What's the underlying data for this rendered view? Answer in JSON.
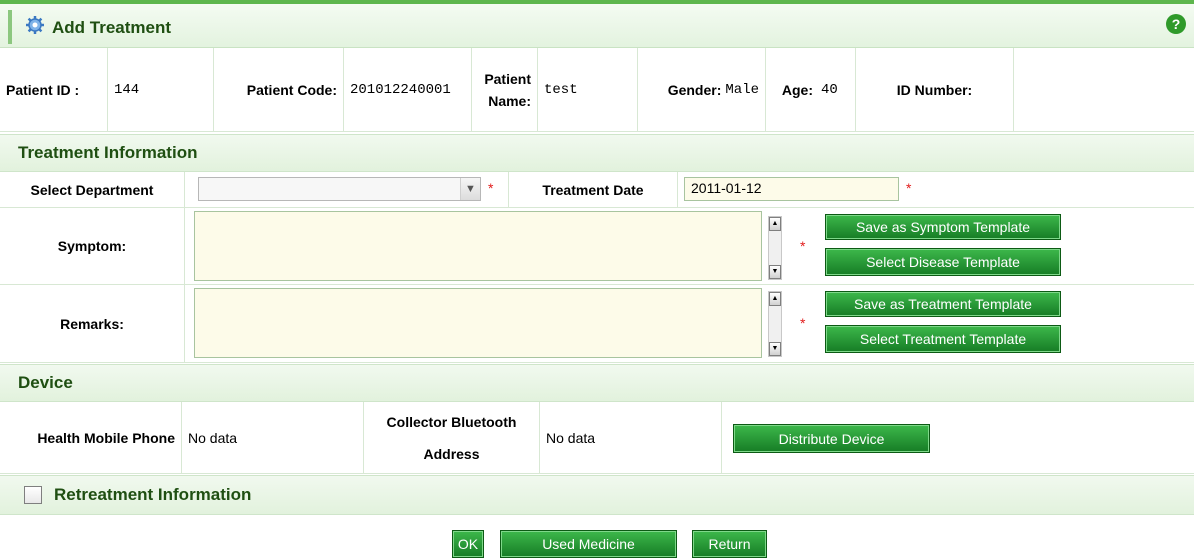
{
  "header": {
    "title": "Add Treatment",
    "help_icon": "help-icon"
  },
  "patient": {
    "id_label": "Patient ID :",
    "id_value": "144",
    "code_label": "Patient Code:",
    "code_value": "201012240001",
    "name_label_1": "Patient",
    "name_label_2": "Name:",
    "name_value": "test",
    "gender_label": "Gender:",
    "gender_value": "Male",
    "age_label": "Age:",
    "age_value": "40",
    "idnum_label": "ID Number:",
    "idnum_value": ""
  },
  "treatment": {
    "section_title": "Treatment Information",
    "department_label": "Select Department",
    "department_value": "",
    "date_label": "Treatment Date",
    "date_value": "2011-01-12",
    "required_mark": "*",
    "symptom_label": "Symptom:",
    "symptom_value": "",
    "remarks_label": "Remarks:",
    "remarks_value": "",
    "save_symptom_btn": "Save as Symptom Template",
    "select_disease_btn": "Select Disease Template",
    "save_treatment_btn": "Save as Treatment Template",
    "select_treatment_btn": "Select Treatment Template"
  },
  "device": {
    "section_title": "Device",
    "phone_label": "Health Mobile Phone",
    "phone_value": "No data",
    "bt_label_1": "Collector Bluetooth",
    "bt_label_2": "Address",
    "bt_value": "No data",
    "distribute_btn": "Distribute Device"
  },
  "retreatment": {
    "section_title": "Retreatment Information",
    "checked": false
  },
  "footer": {
    "ok_btn": "OK",
    "used_medicine_btn": "Used Medicine",
    "return_btn": "Return"
  },
  "colors": {
    "accent_green": "#5db64d",
    "button_green": "#1f8f2c",
    "required_red": "#e21b1b",
    "input_bg": "#fdfbe9"
  }
}
